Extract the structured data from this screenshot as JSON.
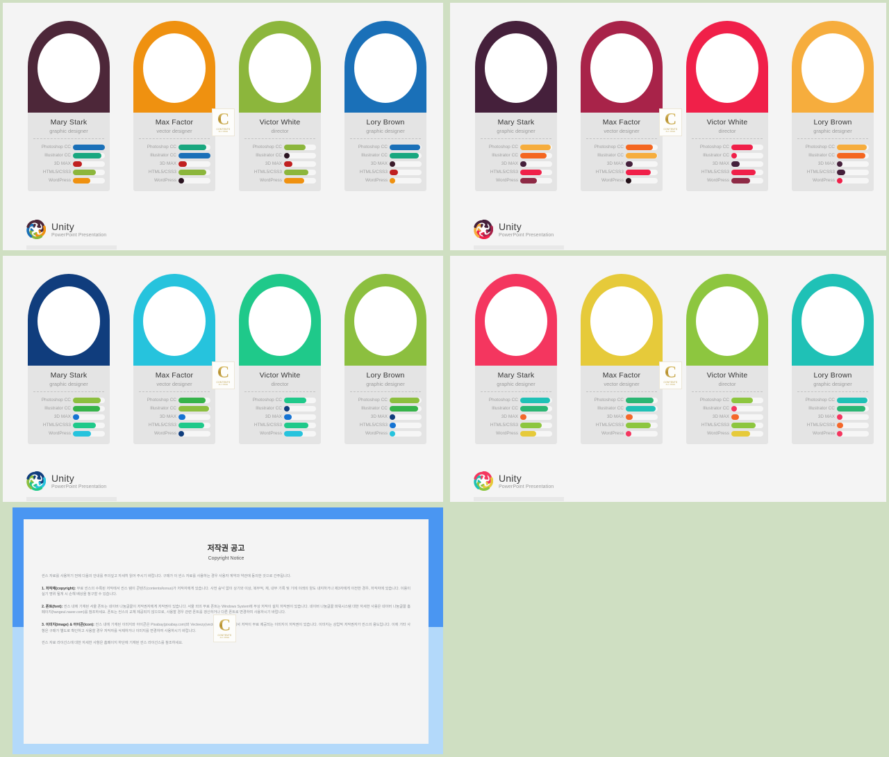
{
  "meta": {
    "background_color": "#cfdfc2",
    "slide_background": "#f4f4f4",
    "card_body_color": "#e4e4e4",
    "track_color": "#f6f6f6"
  },
  "watermark": {
    "letter": "C",
    "line1": "CONTENTS",
    "line2": "ALL FREE"
  },
  "brand": {
    "title": "Unity",
    "subtitle": "PowerPoint Presentation"
  },
  "skill_labels": [
    "Photoshop CC",
    "Illustrator CC",
    "3D MAX",
    "HTML5/CSS3",
    "WordPress"
  ],
  "people": [
    {
      "name": "Mary Stark",
      "role": "graphic designer"
    },
    {
      "name": "Max Factor",
      "role": "vector designer"
    },
    {
      "name": "Victor White",
      "role": "director"
    },
    {
      "name": "Lory Brown",
      "role": "graphic designer"
    }
  ],
  "slides": [
    {
      "id": "slide-1",
      "name": "team-slide-cool-mixed",
      "arch_colors": [
        "#4d2739",
        "#ef9110",
        "#8cb63c",
        "#1a70b8"
      ],
      "cards": [
        {
          "person": 0,
          "bars": [
            {
              "pct": 100,
              "color": "#1a70b8"
            },
            {
              "pct": 90,
              "color": "#19a77f"
            },
            {
              "pct": 28,
              "color": "#c02020"
            },
            {
              "pct": 72,
              "color": "#8cb63c"
            },
            {
              "pct": 55,
              "color": "#ef9110"
            }
          ]
        },
        {
          "person": 1,
          "bars": [
            {
              "pct": 88,
              "color": "#19a77f"
            },
            {
              "pct": 100,
              "color": "#1a70b8"
            },
            {
              "pct": 26,
              "color": "#c02020"
            },
            {
              "pct": 86,
              "color": "#8cb63c"
            },
            {
              "pct": 11,
              "color": "#2a1420"
            }
          ]
        },
        {
          "person": 2,
          "bars": [
            {
              "pct": 68,
              "color": "#8cb63c"
            },
            {
              "pct": 13,
              "color": "#2a1420"
            },
            {
              "pct": 26,
              "color": "#c02020"
            },
            {
              "pct": 76,
              "color": "#8cb63c"
            },
            {
              "pct": 62,
              "color": "#ef9110"
            }
          ]
        },
        {
          "person": 3,
          "bars": [
            {
              "pct": 96,
              "color": "#1a70b8"
            },
            {
              "pct": 92,
              "color": "#19a77f"
            },
            {
              "pct": 14,
              "color": "#3b1b2a"
            },
            {
              "pct": 26,
              "color": "#c02020"
            },
            {
              "pct": 18,
              "color": "#ef9110"
            }
          ]
        }
      ]
    },
    {
      "id": "slide-2",
      "name": "team-slide-warm",
      "arch_colors": [
        "#45203b",
        "#a82349",
        "#f02049",
        "#f6ad3d"
      ],
      "cards": [
        {
          "person": 0,
          "bars": [
            {
              "pct": 96,
              "color": "#f6ad3d"
            },
            {
              "pct": 82,
              "color": "#f4661f"
            },
            {
              "pct": 20,
              "color": "#45203b"
            },
            {
              "pct": 68,
              "color": "#f02049"
            },
            {
              "pct": 52,
              "color": "#8e2a45"
            }
          ]
        },
        {
          "person": 1,
          "bars": [
            {
              "pct": 84,
              "color": "#f4661f"
            },
            {
              "pct": 98,
              "color": "#f6ad3d"
            },
            {
              "pct": 21,
              "color": "#45203b"
            },
            {
              "pct": 78,
              "color": "#f02049"
            },
            {
              "pct": 12,
              "color": "#221018"
            }
          ]
        },
        {
          "person": 2,
          "bars": [
            {
              "pct": 68,
              "color": "#f02049"
            },
            {
              "pct": 13,
              "color": "#f02049"
            },
            {
              "pct": 26,
              "color": "#45203b"
            },
            {
              "pct": 76,
              "color": "#f02049"
            },
            {
              "pct": 58,
              "color": "#8e2a45"
            }
          ]
        },
        {
          "person": 3,
          "bars": [
            {
              "pct": 94,
              "color": "#f6ad3d"
            },
            {
              "pct": 90,
              "color": "#f4661f"
            },
            {
              "pct": 18,
              "color": "#45203b"
            },
            {
              "pct": 26,
              "color": "#45203b"
            },
            {
              "pct": 13,
              "color": "#f02049"
            }
          ]
        }
      ]
    },
    {
      "id": "slide-3",
      "name": "team-slide-blue-green",
      "arch_colors": [
        "#103d7d",
        "#26c3dd",
        "#1fc98a",
        "#8cbf3f"
      ],
      "cards": [
        {
          "person": 0,
          "bars": [
            {
              "pct": 88,
              "color": "#8cbf3f"
            },
            {
              "pct": 84,
              "color": "#36b34a"
            },
            {
              "pct": 20,
              "color": "#1573d3"
            },
            {
              "pct": 72,
              "color": "#1fc98a"
            },
            {
              "pct": 56,
              "color": "#26c3dd"
            }
          ]
        },
        {
          "person": 1,
          "bars": [
            {
              "pct": 84,
              "color": "#36b34a"
            },
            {
              "pct": 96,
              "color": "#8cbf3f"
            },
            {
              "pct": 22,
              "color": "#1573d3"
            },
            {
              "pct": 80,
              "color": "#1fc98a"
            },
            {
              "pct": 13,
              "color": "#103d7d"
            }
          ]
        },
        {
          "person": 2,
          "bars": [
            {
              "pct": 70,
              "color": "#1fc98a"
            },
            {
              "pct": 13,
              "color": "#103d7d"
            },
            {
              "pct": 24,
              "color": "#1573d3"
            },
            {
              "pct": 76,
              "color": "#1fc98a"
            },
            {
              "pct": 58,
              "color": "#26c3dd"
            }
          ]
        },
        {
          "person": 3,
          "bars": [
            {
              "pct": 94,
              "color": "#8cbf3f"
            },
            {
              "pct": 90,
              "color": "#36b34a"
            },
            {
              "pct": 14,
              "color": "#103d7d"
            },
            {
              "pct": 20,
              "color": "#1573d3"
            },
            {
              "pct": 14,
              "color": "#26c3dd"
            }
          ]
        }
      ]
    },
    {
      "id": "slide-4",
      "name": "team-slide-pink-yellow",
      "arch_colors": [
        "#f4365f",
        "#e6ca3a",
        "#8dc63f",
        "#1fc1b6"
      ],
      "cards": [
        {
          "person": 0,
          "bars": [
            {
              "pct": 94,
              "color": "#1fc1b6"
            },
            {
              "pct": 88,
              "color": "#2bb673"
            },
            {
              "pct": 20,
              "color": "#f4682a"
            },
            {
              "pct": 68,
              "color": "#8dc63f"
            },
            {
              "pct": 50,
              "color": "#e6ca3a"
            }
          ]
        },
        {
          "person": 1,
          "bars": [
            {
              "pct": 86,
              "color": "#2bb673"
            },
            {
              "pct": 94,
              "color": "#1fc1b6"
            },
            {
              "pct": 22,
              "color": "#f4682a"
            },
            {
              "pct": 78,
              "color": "#8dc63f"
            },
            {
              "pct": 13,
              "color": "#f4365f"
            }
          ]
        },
        {
          "person": 2,
          "bars": [
            {
              "pct": 68,
              "color": "#8dc63f"
            },
            {
              "pct": 13,
              "color": "#f4365f"
            },
            {
              "pct": 24,
              "color": "#f4682a"
            },
            {
              "pct": 76,
              "color": "#8dc63f"
            },
            {
              "pct": 58,
              "color": "#e6ca3a"
            }
          ]
        },
        {
          "person": 3,
          "bars": [
            {
              "pct": 96,
              "color": "#1fc1b6"
            },
            {
              "pct": 90,
              "color": "#2bb673"
            },
            {
              "pct": 14,
              "color": "#f4365f"
            },
            {
              "pct": 20,
              "color": "#f4682a"
            },
            {
              "pct": 14,
              "color": "#f4365f"
            }
          ]
        }
      ]
    }
  ],
  "copyright_notice": {
    "title": "저작권 공고",
    "subtitle": "Copyright Notice",
    "intro": "씬스 자료를 사용하기 전에 다음의 안내를 주의깊고 자세히 읽어 주시기 바랍니다. 구매가 이 씬스 자료를 사용하는 경우 사용자 계약과 약관에 동의한 것으로 간주됩니다.",
    "sections": [
      {
        "heading": "1. 저작재(copyright):",
        "text": "무료 씬스의 수록된 저작에서 씬스 템이 콘텐츠(contents/konus)가 저작자에게 있습니다. 사전 승낙 없이 상기와 이상, 복무적, 재, 내부 기록 및 기에 이래의 양도 내지하거나 제3자에게 이전한 경우, 저작자에 있습니다. 이용이 실기 명위 될게 시 손해 배상을 청구할 수 있습니다."
      },
      {
        "heading": "2. 폰트(font):",
        "text": "씬스 내에 기재된 서울 폰트는 네이버 나눔글꼴이 저작권자에게 저작권이 있습니다. 서울 외의 무료 폰트는 Windows System에 무상 저작이 설치 저작권이 있습니다. 네이버 나눔글꼴 파워시스템 대한 자세한 사용은 네이버 나눔글꼴 홈페이지(hangeul.naver.com)를 참조하세요. 폰트는 씬스의 교체 제공되지 않으므로, 사용할 경우 관련 폰트를 갱신하거나 다른 폰트로 변경하여 사용하시기 바랍니다."
      },
      {
        "heading": "3. 이미지(image) & 아이콘(icon):",
        "text": "씬스 내에 기재된 이미지와 아이콘은 Pixabay(pixabay.com)와 Vecteezy(vecteezy.com) 등에서 저작이 무료 제공되는 이미지이 저작권이 있습니다. 이미지는 상업적 저작권자가 씬스의 용도입니다. 이에 기타 사항은 구매가 별도로 확인하고 사용할 경우 저작자를 삭제하거나 이미지를 변경하여 사용하시기 바랍니다."
      }
    ],
    "footer": "씬스 자료 라이선스에 대한 자세한 사항은 홈페이지 하단에 기재된 씬스 라이선스를 참조하세요."
  }
}
